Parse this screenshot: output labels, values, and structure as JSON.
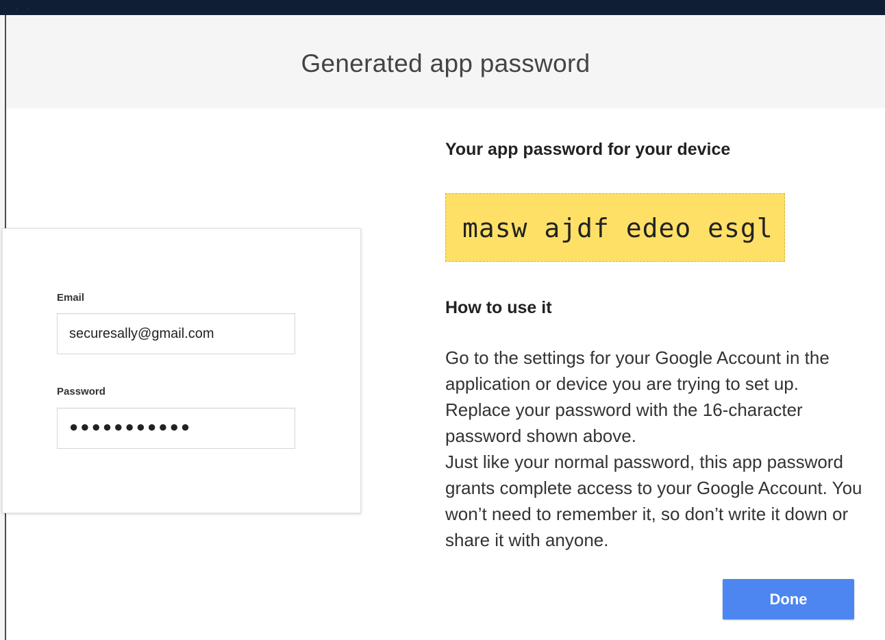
{
  "dialog": {
    "title": "Generated app password"
  },
  "illustration": {
    "email_label": "Email",
    "email_value": "securesally@gmail.com",
    "password_label": "Password",
    "password_value": "●●●●●●●●●●●"
  },
  "content": {
    "device_heading": "Your app password for your device",
    "app_password": "masw ajdf edeo esgl",
    "howto_heading": "How to use it",
    "instructions_p1": "Go to the settings for your Google Account in the application or device you are trying to set up. Replace your password with the 16-character password shown above.",
    "instructions_p2": "Just like your normal password, this app password grants complete access to your Google Account. You won’t need to remember it, so don’t write it down or share it with anyone."
  },
  "actions": {
    "done_label": "Done"
  },
  "colors": {
    "header_bg": "#f5f5f5",
    "password_highlight": "#ffe066",
    "primary_button": "#4d86f0",
    "backdrop": "#0f1e33"
  }
}
